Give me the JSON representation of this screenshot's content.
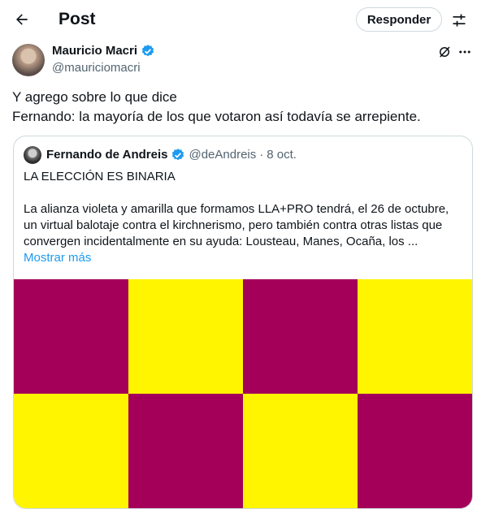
{
  "header": {
    "title": "Post",
    "reply_label": "Responder"
  },
  "post": {
    "author_name": "Mauricio Macri",
    "author_handle": "@mauriciomacri",
    "verified": true,
    "text_lines": [
      "Y agrego sobre lo que dice",
      "Fernando: la mayoría de los que votaron así todavía se arrepiente."
    ]
  },
  "quoted_post": {
    "author_name": "Fernando de Andreis",
    "author_handle": "@deAndreis",
    "separator": "·",
    "date": "8 oct.",
    "verified": true,
    "headline": "LA ELECCIÓN ES BINARIA",
    "body_lines": [
      "La alianza violeta y amarilla que formamos LLA+PRO tendrá, el 26 de octubre,",
      "un virtual balotaje contra el kirchnerismo, pero también contra otras listas que",
      "convergen incidentalmente en su ayuda: Lousteau, Manes, Ocaña, los ..."
    ],
    "show_more": "Mostrar más",
    "media_pattern": [
      [
        "violet",
        "yellow",
        "violet",
        "yellow"
      ],
      [
        "yellow",
        "violet",
        "yellow",
        "violet"
      ]
    ]
  },
  "colors": {
    "violet": "#a4005a",
    "yellow": "#fff500",
    "verified_blue": "#1d9bf0",
    "link_blue": "#1d9bf0",
    "secondary_text": "#536471"
  },
  "icons": {
    "back": "arrow-left-icon",
    "settings": "sliders-icon",
    "verified": "verified-badge-icon",
    "grok": "grok-icon",
    "more": "more-dots-icon"
  }
}
